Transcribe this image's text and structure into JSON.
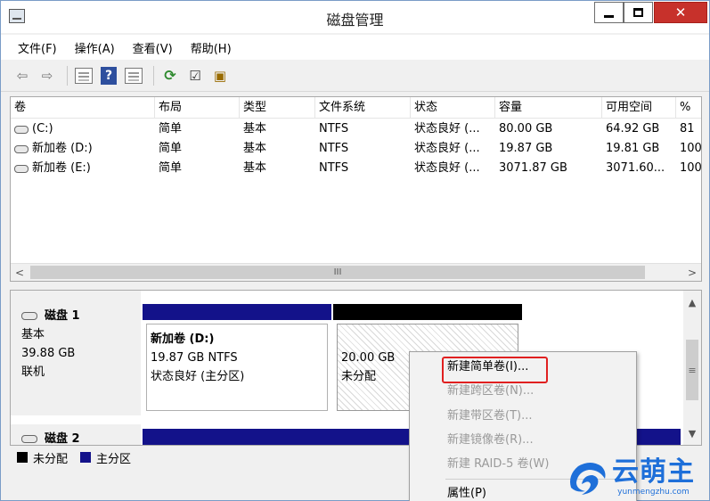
{
  "window": {
    "title": "磁盘管理"
  },
  "menubar": [
    {
      "label": "文件(F)"
    },
    {
      "label": "操作(A)"
    },
    {
      "label": "查看(V)"
    },
    {
      "label": "帮助(H)"
    }
  ],
  "toolbar": {
    "help": "?"
  },
  "volume_list": {
    "columns": [
      "卷",
      "布局",
      "类型",
      "文件系统",
      "状态",
      "容量",
      "可用空间",
      "%"
    ],
    "rows": [
      [
        "(C:)",
        "简单",
        "基本",
        "NTFS",
        "状态良好 (...",
        "80.00 GB",
        "64.92 GB",
        "81"
      ],
      [
        "新加卷 (D:)",
        "简单",
        "基本",
        "NTFS",
        "状态良好 (...",
        "19.87 GB",
        "19.81 GB",
        "100"
      ],
      [
        "新加卷 (E:)",
        "简单",
        "基本",
        "NTFS",
        "状态良好 (...",
        "3071.87 GB",
        "3071.60...",
        "100"
      ]
    ],
    "scroll_thumb_glyph": "III"
  },
  "disks": {
    "disk1": {
      "name": "磁盘 1",
      "type": "基本",
      "size": "39.88 GB",
      "status": "联机",
      "partition_d": {
        "name": "新加卷  (D:)",
        "size_fs": "19.87 GB NTFS",
        "status": "状态良好 (主分区)"
      },
      "partition_unalloc": {
        "size": "20.00 GB",
        "status": "未分配"
      }
    },
    "disk2": {
      "name": "磁盘 2"
    }
  },
  "legend": [
    {
      "label": "未分配",
      "color": "#000000"
    },
    {
      "label": "主分区",
      "color": "#13128a"
    }
  ],
  "context_menu": {
    "items": [
      {
        "label": "新建简单卷(I)...",
        "enabled": true
      },
      {
        "label": "新建跨区卷(N)...",
        "enabled": false
      },
      {
        "label": "新建带区卷(T)...",
        "enabled": false
      },
      {
        "label": "新建镜像卷(R)...",
        "enabled": false
      },
      {
        "label": "新建 RAID-5 卷(W)",
        "enabled": false
      },
      {
        "label": "属性(P)",
        "enabled": true
      }
    ],
    "highlight_color": "#e02020"
  },
  "watermark": {
    "title": "云萌主",
    "subtitle": "yunmengzhu.com",
    "color": "#1e6fd9"
  }
}
